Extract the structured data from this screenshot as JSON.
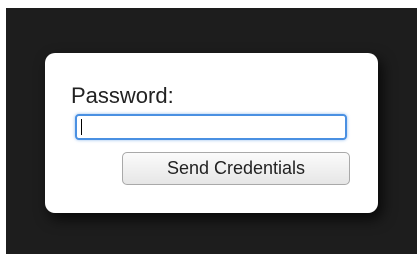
{
  "form": {
    "password_label": "Password:",
    "password_value": "",
    "submit_label": "Send Credentials"
  }
}
